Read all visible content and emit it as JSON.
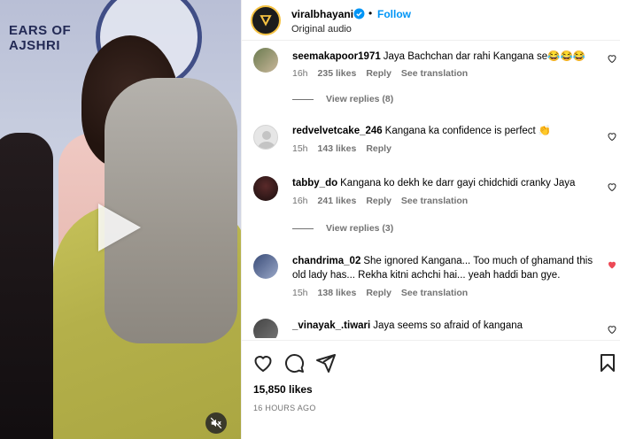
{
  "media": {
    "backdrop_line1": "EARS OF",
    "backdrop_line2": "AJSHRI"
  },
  "header": {
    "username": "viralbhayani",
    "follow_label": "Follow",
    "dot": "•",
    "audio_label": "Original audio"
  },
  "comments": [
    {
      "username": "seemakapoor1971",
      "text": "Jaya Bachchan dar rahi Kangana se😂😂😂",
      "time": "16h",
      "likes": "235 likes",
      "reply": "Reply",
      "translation": "See translation",
      "liked": false
    },
    {
      "username": "redvelvetcake_246",
      "text": "Kangana ka confidence is perfect 👏",
      "time": "15h",
      "likes": "143 likes",
      "reply": "Reply",
      "translation": "",
      "liked": false
    },
    {
      "username": "tabby_do",
      "text": "Kangana ko dekh ke darr gayi chidchidi cranky Jaya",
      "time": "16h",
      "likes": "241 likes",
      "reply": "Reply",
      "translation": "See translation",
      "liked": false
    },
    {
      "username": "chandrima_02",
      "text": "She ignored Kangana... Too much of ghamand this old lady has... Rekha kitni achchi hai... yeah haddi ban gye.",
      "time": "15h",
      "likes": "138 likes",
      "reply": "Reply",
      "translation": "See translation",
      "liked": true
    },
    {
      "username": "_vinayak_.tiwari",
      "text": "Jaya seems so afraid of kangana",
      "time": "",
      "likes": "",
      "reply": "",
      "translation": "",
      "liked": false
    }
  ],
  "view_replies": [
    {
      "label": "View replies (8)"
    },
    {
      "label": "View replies (3)"
    }
  ],
  "footer": {
    "likes": "15,850 likes",
    "ago": "16 HOURS AGO"
  },
  "colors": {
    "accent": "#0095f6",
    "heart_liked": "#ed4956",
    "meta": "#737373"
  }
}
